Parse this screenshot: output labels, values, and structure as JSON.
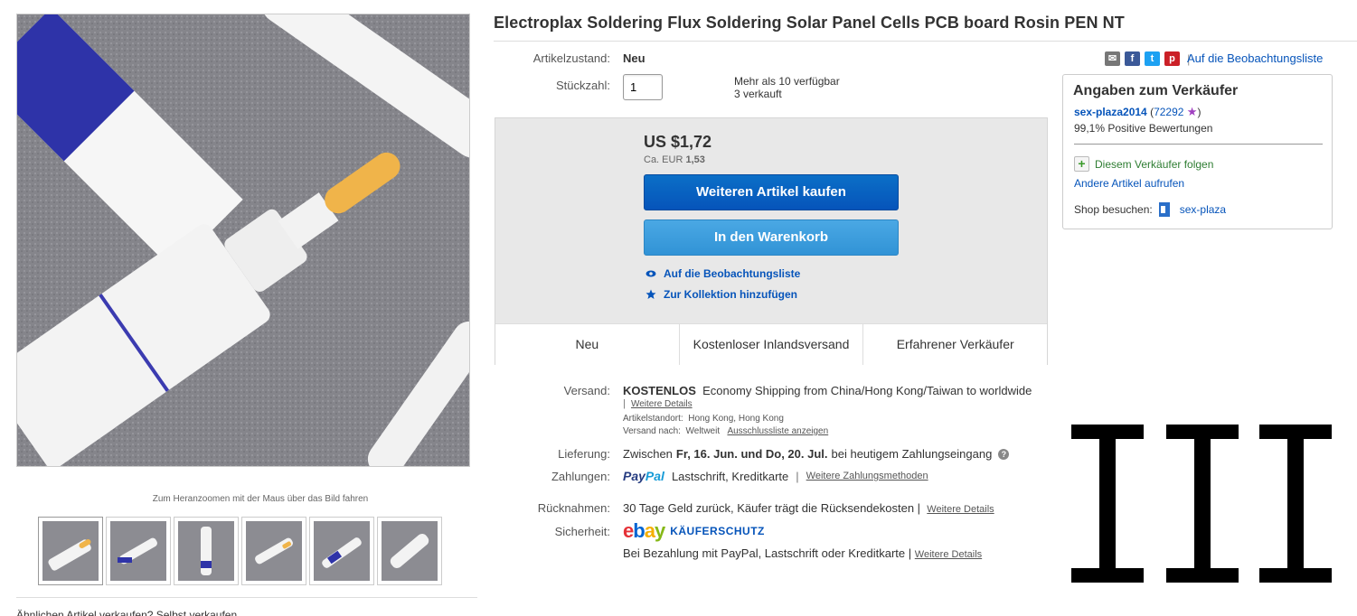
{
  "title": "Electroplax Soldering Flux Soldering Solar Panel Cells PCB board Rosin PEN NT",
  "gallery": {
    "zoom_hint": "Zum Heranzoomen mit der Maus über das Bild fahren",
    "thumb_count": 6,
    "similar_text": "Ähnlichen Artikel verkaufen?  Selbst verkaufen"
  },
  "condition": {
    "label": "Artikelzustand:",
    "value": "Neu"
  },
  "quantity": {
    "label": "Stückzahl:",
    "value": "1",
    "available": "Mehr als 10 verfügbar",
    "sold": "3 verkauft"
  },
  "buybox": {
    "price": "US $1,72",
    "price_eur_prefix": "Ca. EUR",
    "price_eur_value": "1,53",
    "buy_now": "Weiteren Artikel kaufen",
    "add_to_cart": "In den Warenkorb",
    "watch": "Auf die Beobachtungsliste",
    "collection": "Zur Kollektion hinzufügen",
    "badges": [
      "Neu",
      "Kostenloser Inlandsversand",
      "Erfahrener Verkäufer"
    ]
  },
  "shipping": {
    "label": "Versand:",
    "cost": "KOSTENLOS",
    "method": "Economy Shipping from China/Hong Kong/Taiwan to worldwide",
    "details_link": "Weitere Details",
    "location_label": "Artikelstandort:",
    "location": "Hong Kong, Hong Kong",
    "ships_to_label": "Versand nach:",
    "ships_to": "Weltweit",
    "exclusions_link": "Ausschlussliste anzeigen"
  },
  "delivery": {
    "label": "Lieferung:",
    "prefix": "Zwischen",
    "range": "Fr, 16. Jun. und Do, 20. Jul.",
    "suffix": "bei heutigem Zahlungseingang"
  },
  "payments": {
    "label": "Zahlungen:",
    "paypal_1": "Pay",
    "paypal_2": "Pal",
    "methods": "Lastschrift,  Kreditkarte",
    "more_link": "Weitere Zahlungsmethoden"
  },
  "returns": {
    "label": "Rücknahmen:",
    "text": "30 Tage Geld zurück, Käufer trägt die Rücksendekosten",
    "details_link": "Weitere Details"
  },
  "security": {
    "label": "Sicherheit:",
    "ebay": [
      "e",
      "b",
      "a",
      "y"
    ],
    "program": "KÄUFERSCHUTZ",
    "text": "Bei Bezahlung mit PayPal, Lastschrift oder Kreditkarte",
    "details_link": "Weitere Details"
  },
  "share": {
    "icons": [
      "mail-icon",
      "facebook-icon",
      "twitter-icon",
      "pinterest-icon"
    ],
    "watch": "Auf die Beobachtungsliste"
  },
  "seller": {
    "heading": "Angaben zum Verkäufer",
    "name": "sex-plaza2014",
    "score": "72292",
    "positive": "99,1% Positive Bewertungen",
    "follow": "Diesem Verkäufer folgen",
    "other_items": "Andere Artikel aufrufen",
    "shop_label": "Shop besuchen:",
    "shop_name": "sex-plaza"
  },
  "colors": {
    "link": "#0654ba",
    "buy_button": "#0654ba",
    "cart_button": "#3193d6",
    "buybox_bg": "#e8e8e8",
    "follow_green": "#2e7d32"
  }
}
